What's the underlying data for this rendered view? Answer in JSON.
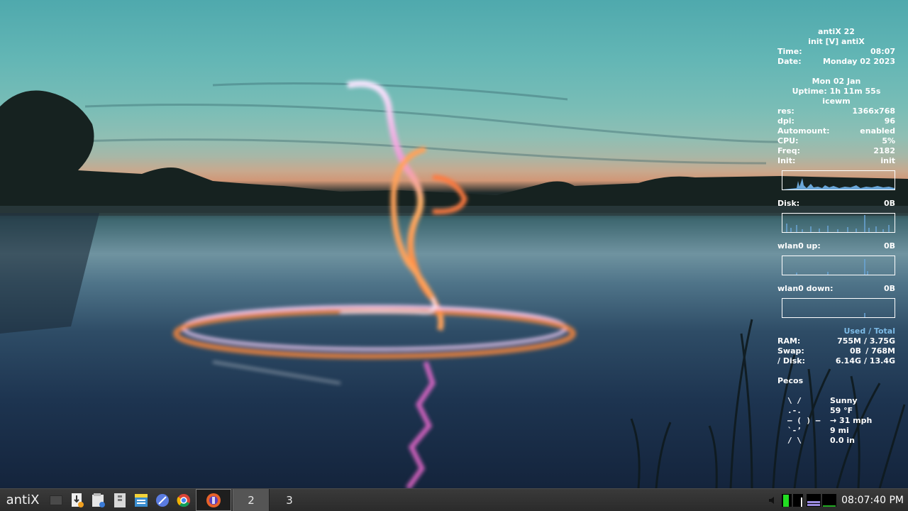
{
  "conky": {
    "os": "antiX 22",
    "init_line": "init [V] antiX",
    "time_label": "Time:",
    "time_value": "08:07",
    "date_label": "Date:",
    "date_value": "Monday 02 2023",
    "short_date": "Mon 02 Jan",
    "uptime": "Uptime: 1h 11m 55s",
    "wm": "icewm",
    "stats": [
      {
        "label": "res:",
        "value": "1366x768"
      },
      {
        "label": "dpi:",
        "value": "96"
      },
      {
        "label": "Automount:",
        "value": "enabled"
      },
      {
        "label": "CPU:",
        "value": "5%"
      },
      {
        "label": "Freq:",
        "value": "2182"
      },
      {
        "label": "Init:",
        "value": "init"
      }
    ],
    "disk_label": "Disk:",
    "disk_value": "0B",
    "wlan_up_label": "wlan0 up:",
    "wlan_up_value": "0B",
    "wlan_down_label": "wlan0 down:",
    "wlan_down_value": "0B",
    "used_total_header": "Used / Total",
    "mem": [
      {
        "label": "RAM:",
        "used": "755M",
        "total": "/ 3.75G"
      },
      {
        "label": "Swap:",
        "used": "0B",
        "total": "/ 768M"
      },
      {
        "label": "/ Disk:",
        "used": "6.14G",
        "total": "/ 13.4G"
      }
    ],
    "weather": {
      "location": "Pecos",
      "lines": [
        {
          "art": " \\  /",
          "text": "Sunny"
        },
        {
          "art": " .-.",
          "text": "59 °F"
        },
        {
          "art": "― (  ) ―",
          "text": "→ 31 mph"
        },
        {
          "art": " `-’",
          "text": "9 mi"
        },
        {
          "art": " /  \\",
          "text": "0.0 in"
        }
      ]
    }
  },
  "taskbar": {
    "start_label": "antiX",
    "quick_launch": [
      "show-desktop-icon",
      "installer-icon",
      "file-manager-icon",
      "archive-icon",
      "editor-icon",
      "browser-seamonkey-icon",
      "chrome-icon"
    ],
    "workspaces": [
      "2",
      "3"
    ],
    "clock": "08:07:40 PM",
    "tray": [
      "volume-icon",
      "cpu-monitor-icon",
      "memory-monitor-icon",
      "network-monitor-icon"
    ]
  },
  "colors": {
    "accent_blue": "#79b9e0",
    "taskbar_bg": "#2b2b2b",
    "cpu_meter_green": "#22dd22"
  }
}
